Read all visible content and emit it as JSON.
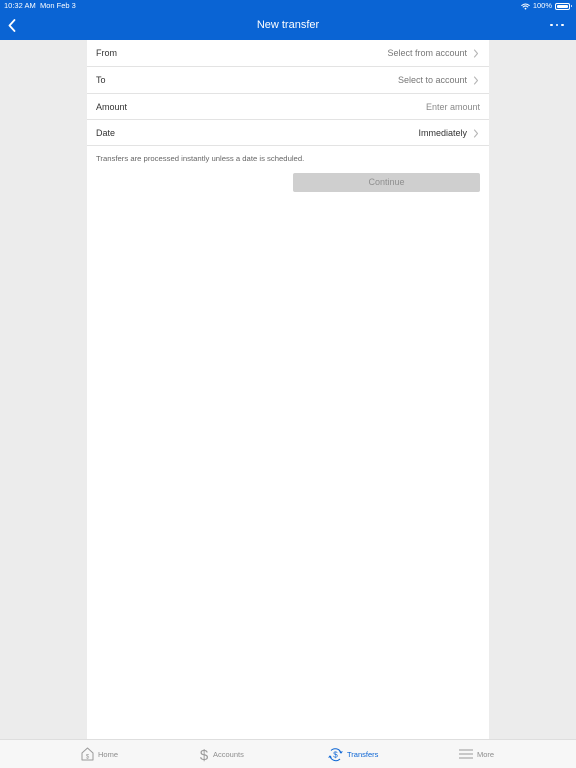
{
  "status": {
    "time": "10:32 AM",
    "date": "Mon Feb 3",
    "battery": "100%"
  },
  "header": {
    "title": "New transfer"
  },
  "form": {
    "from": {
      "label": "From",
      "value": "Select from account"
    },
    "to": {
      "label": "To",
      "value": "Select to account"
    },
    "amount": {
      "label": "Amount",
      "placeholder": "Enter amount"
    },
    "date": {
      "label": "Date",
      "value": "Immediately"
    },
    "info": "Transfers are processed instantly unless a date is scheduled.",
    "continue_label": "Continue"
  },
  "tabs": {
    "items": [
      {
        "label": "Home",
        "icon": "home-icon"
      },
      {
        "label": "Accounts",
        "icon": "dollar-icon"
      },
      {
        "label": "Transfers",
        "icon": "transfer-icon"
      },
      {
        "label": "More",
        "icon": "menu-icon"
      }
    ],
    "active": "Transfers"
  },
  "colors": {
    "brand": "#0a64d4",
    "background": "#ececec",
    "button_disabled": "#cfcfcf"
  }
}
